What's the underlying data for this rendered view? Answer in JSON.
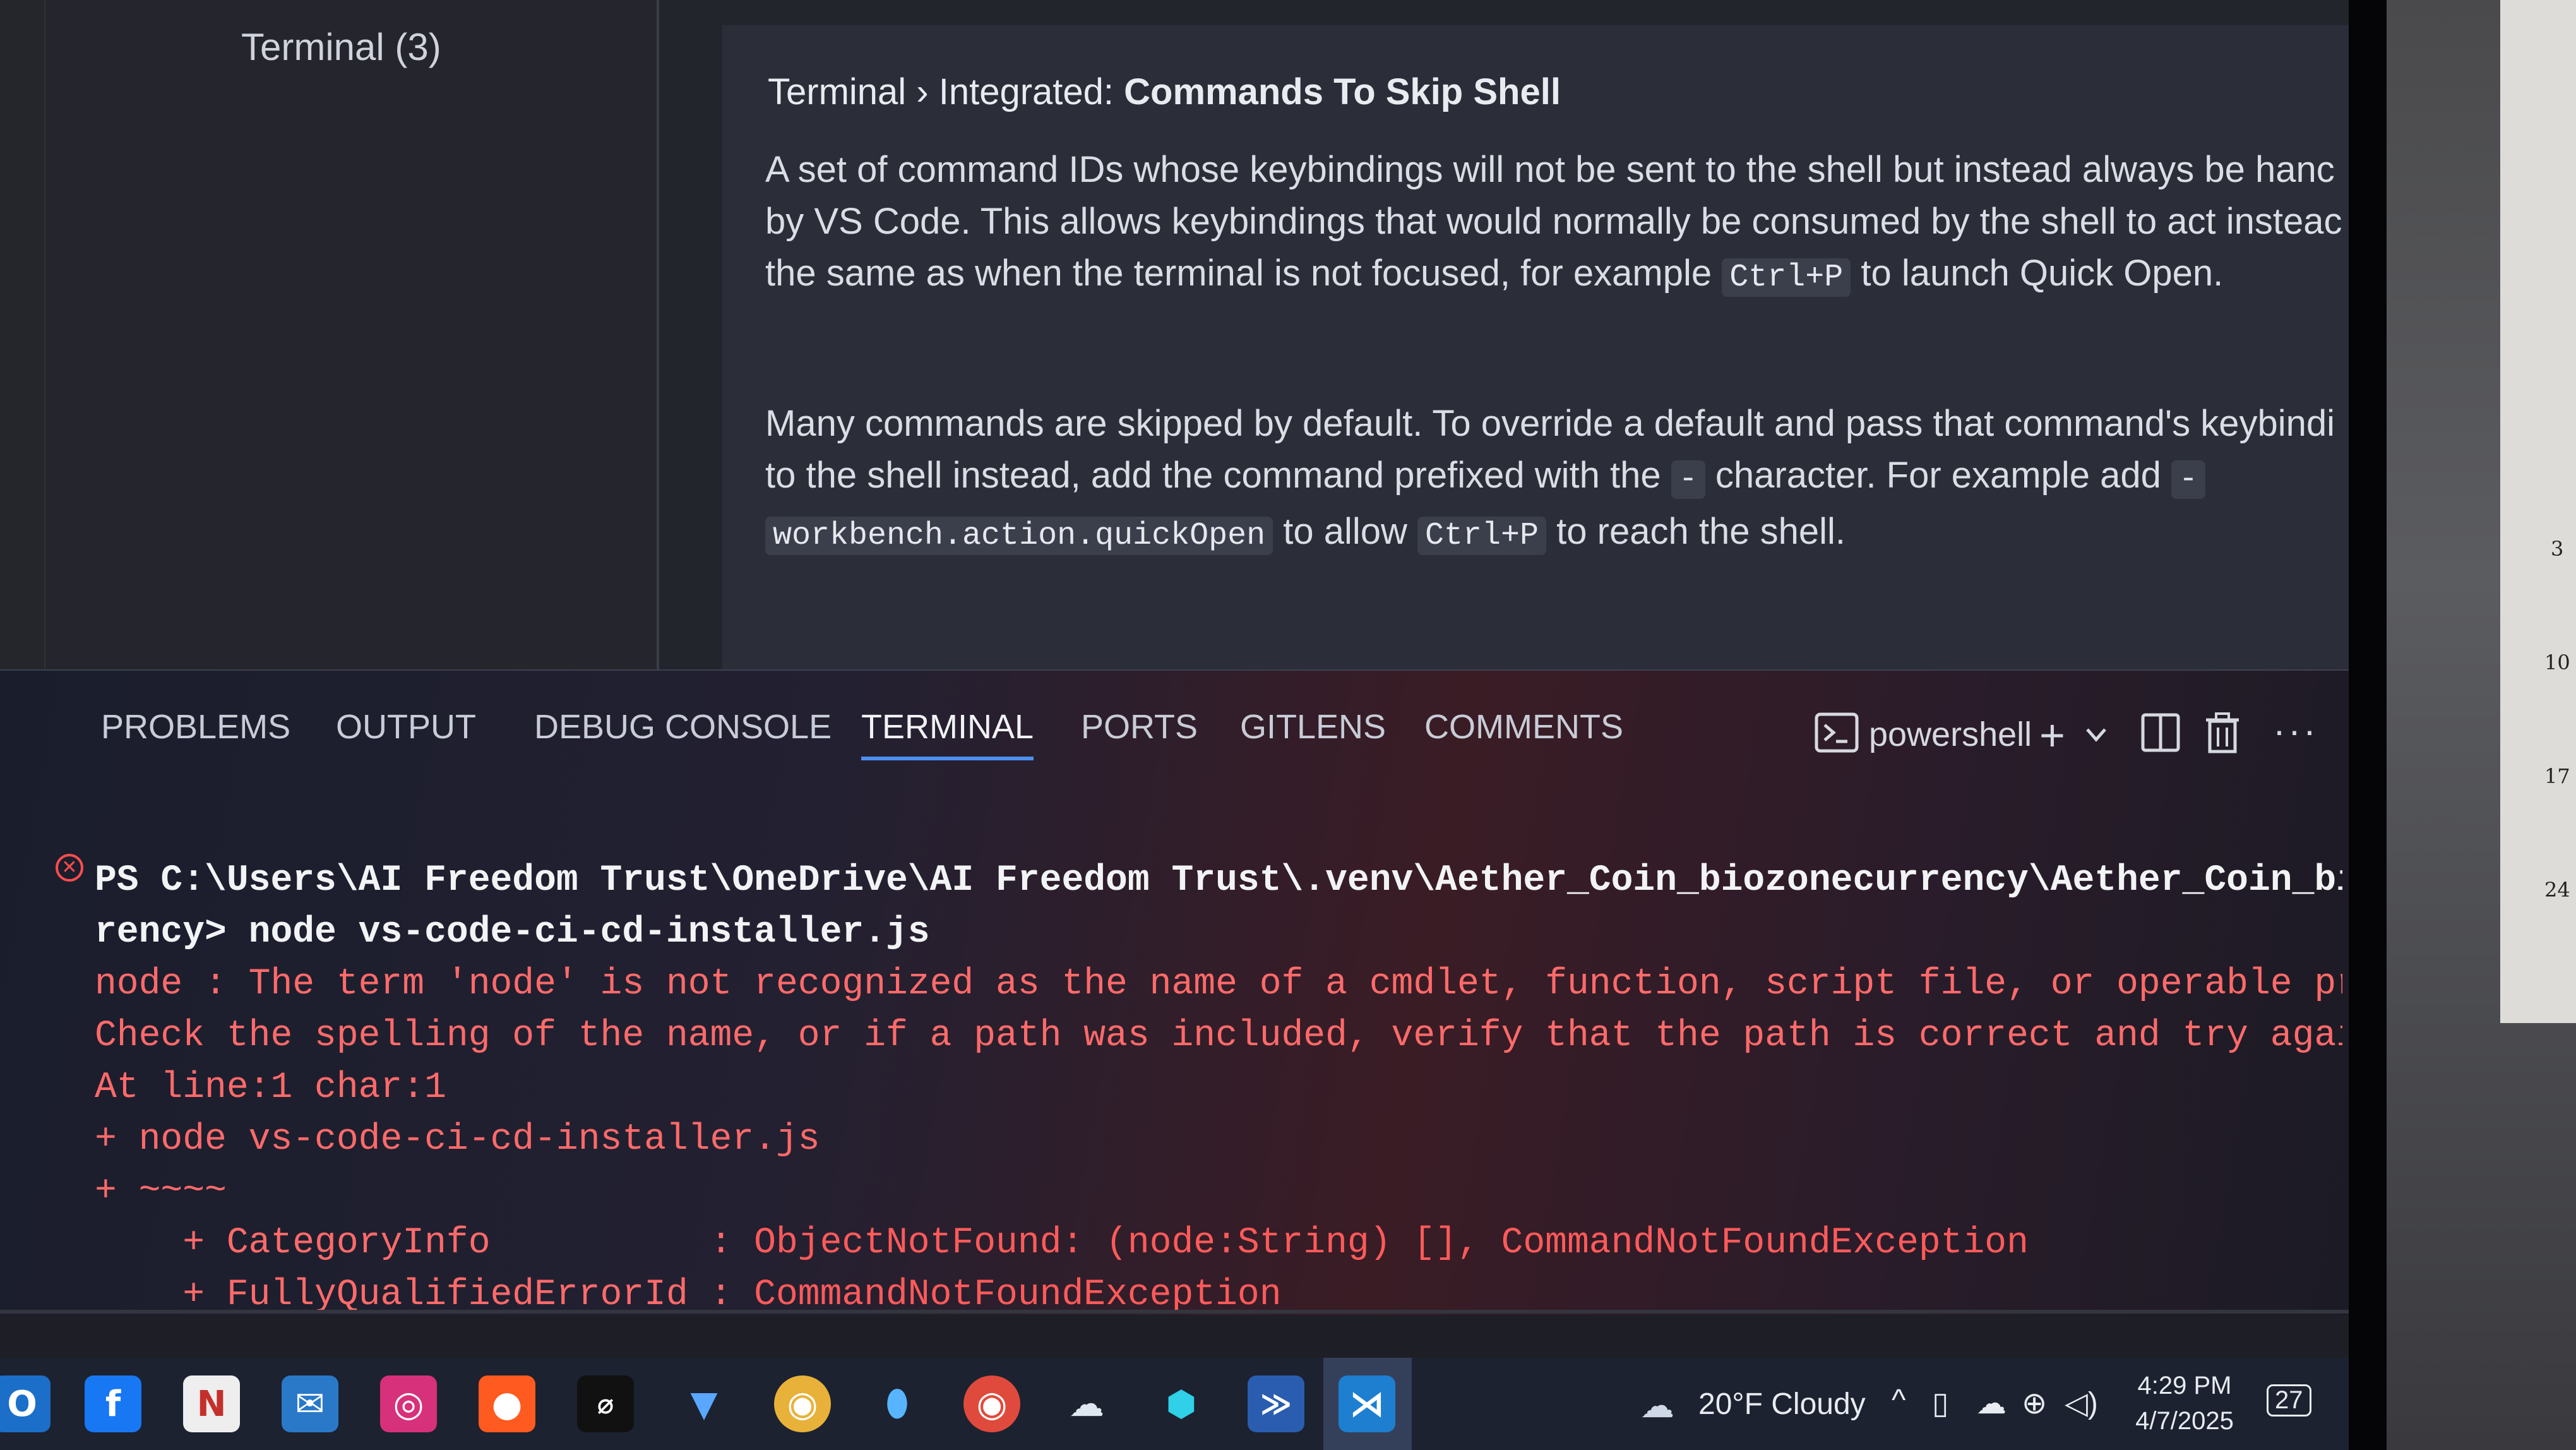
{
  "settings": {
    "toc_item": "Terminal (3)",
    "title_prefix": "Terminal › Integrated: ",
    "title_bold": "Commands To Skip Shell",
    "desc": {
      "l1": "A set of command IDs whose keybindings will not be sent to the shell but instead always be hanc",
      "l2": "by VS Code. This allows keybindings that would normally be consumed by the shell to act insteac",
      "l3a": "the same as when the terminal is not focused, for example ",
      "l3code": "Ctrl+P",
      "l3b": " to launch Quick Open.",
      "p2l1": "Many commands are skipped by default. To override a default and pass that command's keybindi",
      "p2l2a": "to the shell instead, add the command prefixed with the ",
      "p2l2code": "-",
      "p2l2b": " character. For example add ",
      "p2l2code2": "-",
      "p2l3code": "workbench.action.quickOpen",
      "p2l3a": " to allow ",
      "p2l3code2": "Ctrl+P",
      "p2l3b": " to reach the shell."
    }
  },
  "panel": {
    "tabs": [
      "PROBLEMS",
      "OUTPUT",
      "DEBUG CONSOLE",
      "TERMINAL",
      "PORTS",
      "GITLENS",
      "COMMENTS"
    ],
    "active_tab": "TERMINAL",
    "shell_label": "powershell"
  },
  "terminal": {
    "line1": "PS C:\\Users\\AI Freedom Trust\\OneDrive\\AI Freedom Trust\\.venv\\Aether_Coin_biozonecurrency\\Aether_Coin_bioz",
    "line2": "rency> node vs-code-ci-cd-installer.js",
    "line3": "node : The term 'node' is not recognized as the name of a cmdlet, function, script file, or operable prog",
    "line4": "Check the spelling of the name, or if a path was included, verify that the path is correct and try again.",
    "line5": "At line:1 char:1",
    "line6": "+ node vs-code-ci-cd-installer.js",
    "line7": "+ ~~~~",
    "line8a": "    + CategoryInfo          : ",
    "line8b": "ObjectNotFound: (node:String) [], CommandNotFoundException",
    "line9a": "    + FullyQualifiedErrorId : ",
    "line9b": "CommandNotFoundException"
  },
  "taskbar": {
    "weather": "20°F  Cloudy",
    "time": "4:29 PM",
    "date": "4/7/2025",
    "notification_count": "27",
    "icons": [
      "outlook-icon",
      "facebook-icon",
      "notion-icon",
      "outlook-mail-icon",
      "instagram-icon",
      "reddit-icon",
      "app-icon",
      "vivaldi-icon",
      "chrome-icon",
      "maps-icon",
      "chrome-profile-icon",
      "cloud-app-icon",
      "cube-app-icon",
      "powershell-icon",
      "vscode-icon"
    ]
  },
  "colors": {
    "accent": "#4d8ff0",
    "error": "#ff5a5a",
    "terminal_bg": "#1a1e2c"
  }
}
